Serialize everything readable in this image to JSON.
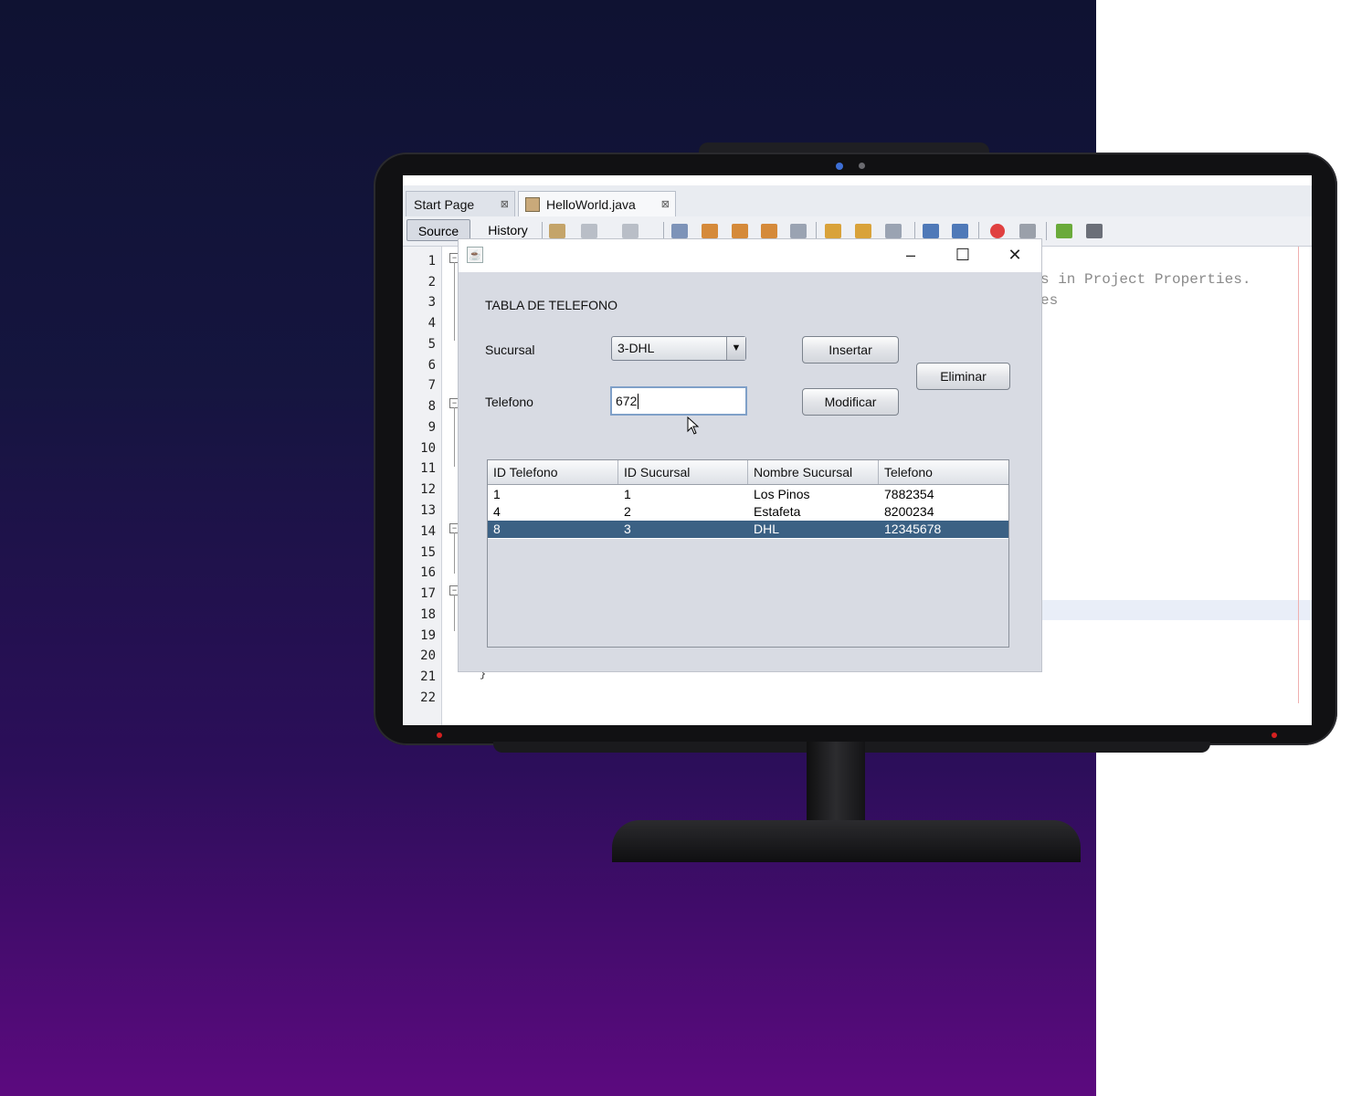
{
  "ide": {
    "tabs": [
      {
        "label": "Start Page"
      },
      {
        "label": "HelloWorld.java"
      }
    ],
    "tab_close_glyph": "⊠",
    "toolbar": {
      "source_label": "Source",
      "history_label": "History"
    },
    "line_numbers": [
      "1",
      "2",
      "3",
      "4",
      "5",
      "6",
      "7",
      "8",
      "9",
      "10",
      "11",
      "12",
      "13",
      "14",
      "15",
      "16",
      "17",
      "18",
      "19",
      "20",
      "21",
      "22"
    ],
    "code_fragments": {
      "line2": "s in Project Properties.",
      "line3": "es",
      "line21": "}"
    }
  },
  "dialog": {
    "title": "",
    "heading": "TABLA DE TELEFONO",
    "sucursal_label": "Sucursal",
    "telefono_label": "Telefono",
    "sucursal_selected": "3-DHL",
    "telefono_value": "672",
    "buttons": {
      "insertar": "Insertar",
      "modificar": "Modificar",
      "eliminar": "Eliminar"
    },
    "table": {
      "columns": [
        "ID Telefono",
        "ID Sucursal",
        "Nombre Sucursal",
        "Telefono"
      ],
      "rows": [
        {
          "id_telefono": "1",
          "id_sucursal": "1",
          "nombre_sucursal": "Los Pinos",
          "telefono": "7882354"
        },
        {
          "id_telefono": "4",
          "id_sucursal": "2",
          "nombre_sucursal": "Estafeta",
          "telefono": "8200234"
        },
        {
          "id_telefono": "8",
          "id_sucursal": "3",
          "nombre_sucursal": "DHL",
          "telefono": "12345678"
        }
      ],
      "selected_row": 3
    }
  },
  "colors": {
    "selection": "#3b6184",
    "background_top": "#0f1232",
    "background_bottom": "#5c0a7f"
  }
}
